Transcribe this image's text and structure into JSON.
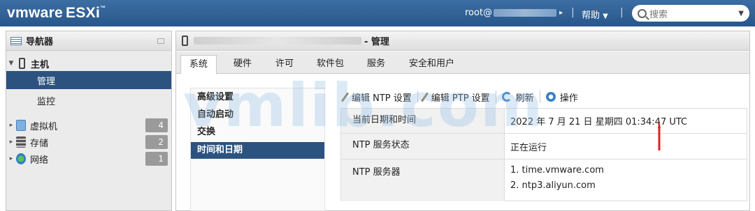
{
  "header": {
    "logo_brand": "vmware",
    "logo_product": "ESXi",
    "user_label": "root@",
    "help_label": "帮助",
    "search_placeholder": "搜索"
  },
  "navigator": {
    "title": "导航器",
    "host_label": "主机",
    "items": [
      {
        "label": "管理",
        "selected": true
      },
      {
        "label": "监控",
        "selected": false
      }
    ],
    "groups": [
      {
        "label": "虚拟机",
        "count": "4",
        "icon": "vm-icon"
      },
      {
        "label": "存储",
        "count": "2",
        "icon": "storage-icon"
      },
      {
        "label": "网络",
        "count": "1",
        "icon": "network-icon"
      }
    ]
  },
  "main": {
    "title_suffix": "- 管理",
    "tabs": [
      "系统",
      "硬件",
      "许可",
      "软件包",
      "服务",
      "安全和用户"
    ],
    "active_tab": "系统",
    "side_menu": [
      "高级设置",
      "自动启动",
      "交换",
      "时间和日期"
    ],
    "selected_side": "时间和日期",
    "toolbar": {
      "edit_ntp": "编辑 NTP 设置",
      "edit_ptp": "编辑 PTP 设置",
      "refresh": "刷新",
      "actions": "操作"
    },
    "table": [
      {
        "key": "当前日期和时间",
        "value": "2022 年 7 月 21 日 星期四 01:34:47 UTC"
      },
      {
        "key": "NTP 服务状态",
        "value": "正在运行"
      },
      {
        "key": "NTP 服务器",
        "values": [
          "1. time.vmware.com",
          "2. ntp3.aliyun.com"
        ]
      }
    ]
  },
  "watermark": "vmlib.com",
  "colors": {
    "header": "#2f5f94",
    "selected": "#2c5280",
    "arrow": "#e02020"
  }
}
